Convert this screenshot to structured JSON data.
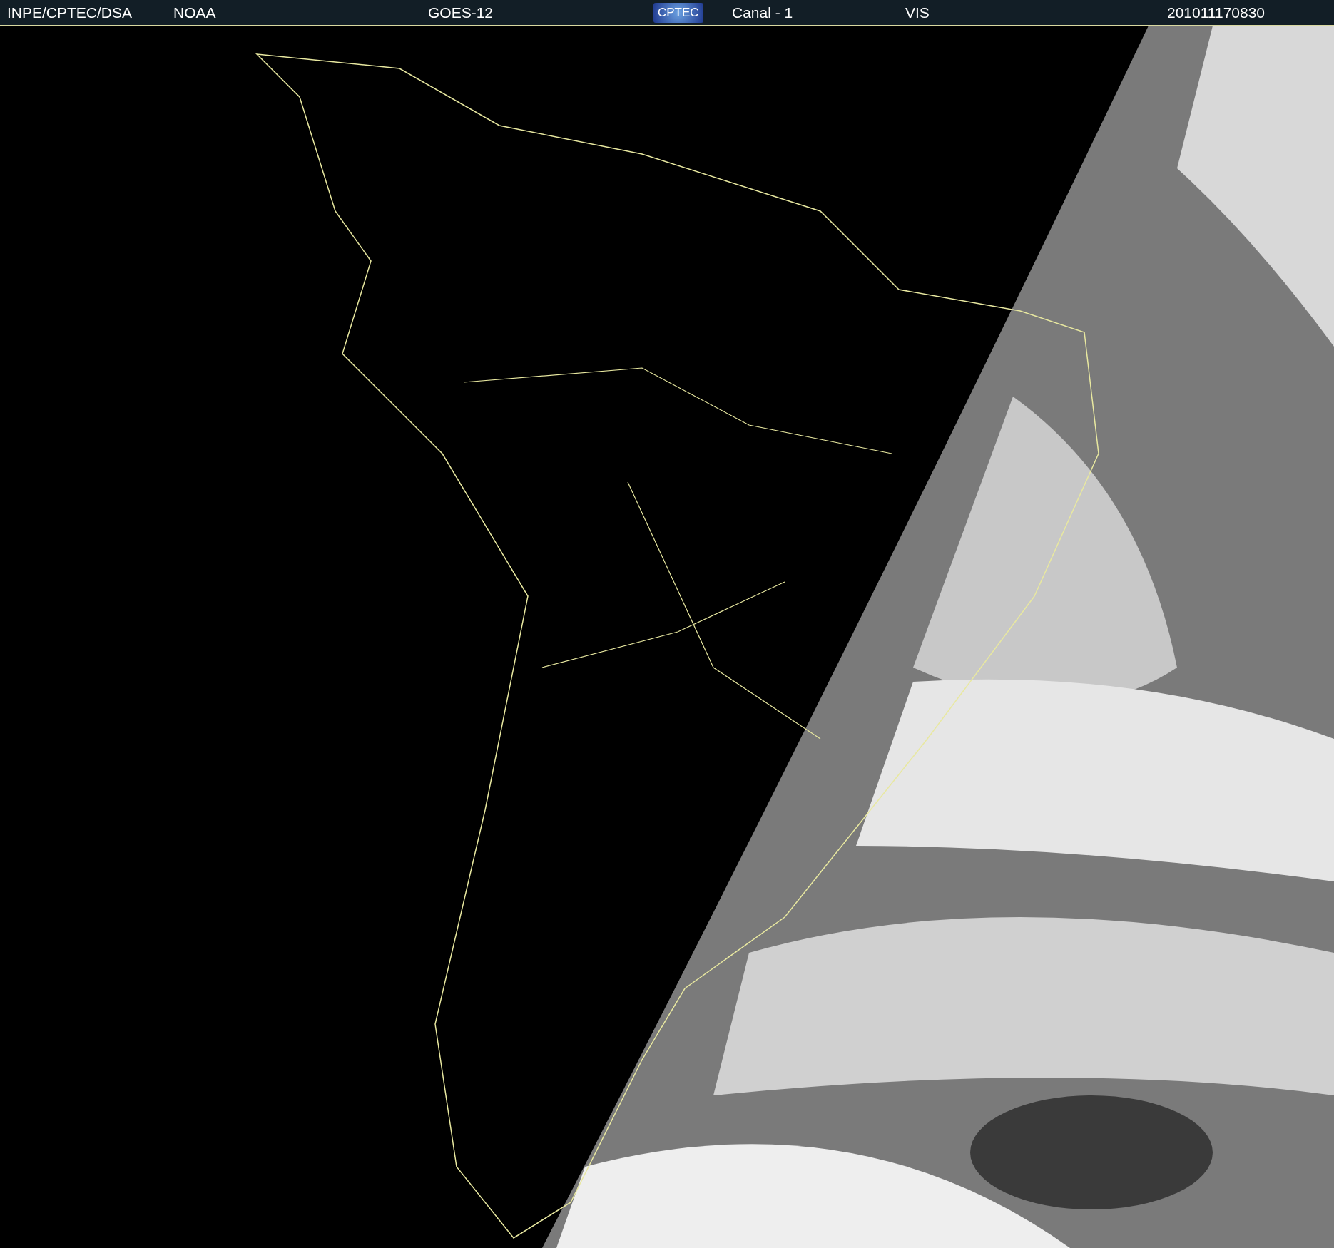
{
  "header": {
    "items": [
      {
        "kind": "text",
        "text": "INPE/CPTEC/DSA"
      },
      {
        "kind": "text",
        "text": "NOAA"
      },
      {
        "kind": "text",
        "text": "GOES-12"
      },
      {
        "kind": "logo",
        "text": "CPTEC"
      },
      {
        "kind": "text",
        "text": "Canal - 1"
      },
      {
        "kind": "text",
        "text": "VIS"
      },
      {
        "kind": "text",
        "text": "201011170830"
      }
    ]
  }
}
